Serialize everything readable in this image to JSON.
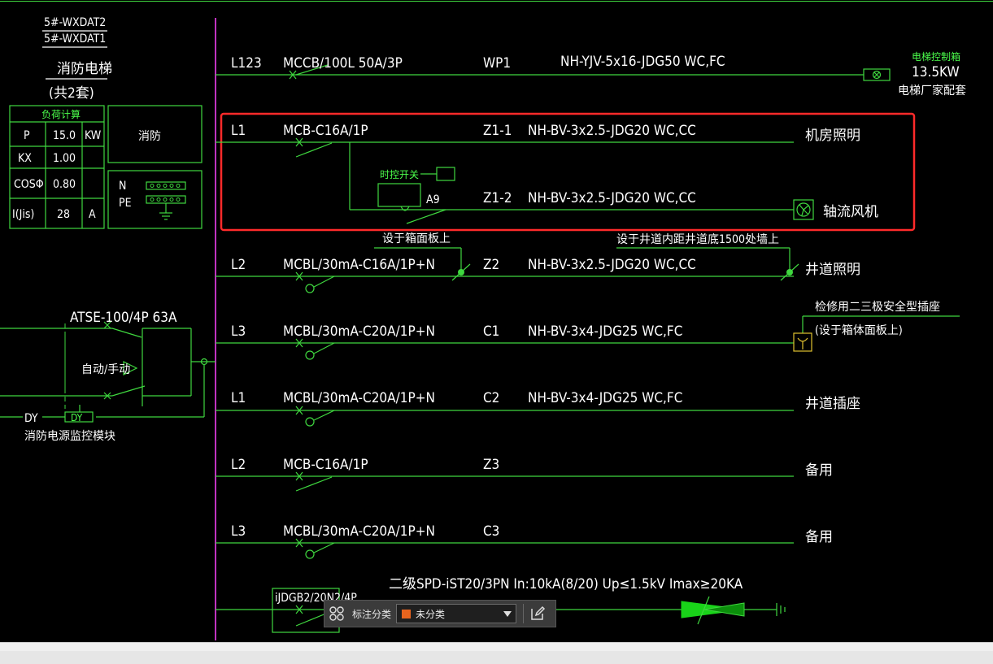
{
  "panel": {
    "ids": [
      "5#-WXDAT2",
      "5#-WXDAT1"
    ],
    "title": "消防电梯",
    "count": "(共2套)",
    "load_table_title": "负荷计算",
    "load_rows": [
      {
        "param": "P",
        "value": "15.0",
        "unit": "KW"
      },
      {
        "param": "KX",
        "value": "1.00",
        "unit": ""
      },
      {
        "param": "COSΦ",
        "value": "0.80",
        "unit": ""
      },
      {
        "param": "I(Jis)",
        "value": "28",
        "unit": "A"
      }
    ],
    "fire_label": "消防",
    "n_label": "N",
    "pe_label": "PE"
  },
  "atse": {
    "label": "ATSE-100/4P 63A",
    "mode_label": "自动/手动",
    "dy_box": "DY",
    "dy_line": "DY",
    "monitor_label": "消防电源监控模块"
  },
  "circuits": [
    {
      "phase": "L123",
      "breaker": "MCCB/100L 50A/3P",
      "id": "WP1",
      "cable": "NH-YJV-5x16-JDG50  WC,FC",
      "load": ""
    },
    {
      "phase": "L1",
      "breaker": "MCB-C16A/1P",
      "id": "Z1-1",
      "cable": "NH-BV-3x2.5-JDG20  WC,CC",
      "load": "机房照明"
    },
    {
      "phase": "",
      "breaker": "",
      "id": "Z1-2",
      "cable": "NH-BV-3x2.5-JDG20  WC,CC",
      "load": "轴流风机"
    },
    {
      "phase": "L2",
      "breaker": "MCBL/30mA-C16A/1P+N",
      "id": "Z2",
      "cable": "NH-BV-3x2.5-JDG20  WC,CC",
      "load": "井道照明"
    },
    {
      "phase": "L3",
      "breaker": "MCBL/30mA-C20A/1P+N",
      "id": "C1",
      "cable": "NH-BV-3x4-JDG25  WC,FC",
      "load": ""
    },
    {
      "phase": "L1",
      "breaker": "MCBL/30mA-C20A/1P+N",
      "id": "C2",
      "cable": "NH-BV-3x4-JDG25  WC,FC",
      "load": "井道插座"
    },
    {
      "phase": "L2",
      "breaker": "MCB-C16A/1P",
      "id": "Z3",
      "cable": "",
      "load": "备用"
    },
    {
      "phase": "L3",
      "breaker": "MCBL/30mA-C20A/1P+N",
      "id": "C3",
      "cable": "",
      "load": "备用"
    }
  ],
  "elevator_ctrl": {
    "title": "电梯控制箱",
    "power": "13.5KW",
    "note": "电梯厂家配套"
  },
  "timer_switch": "时控开关",
  "a9_label": "A9",
  "note_on_panel": "设于箱面板上",
  "note_shaft": "设于井道内距井道底1500处墙上",
  "socket_note1": "检修用二三极安全型插座",
  "socket_note2": "(设于箱体面板上)",
  "spd": {
    "label": "二级SPD-iST20/3PN In:10kA(8/20) Up≤1.5kV Imax≥20KA",
    "breaker": "iJDGB2/20N2/4P"
  },
  "toolbar": {
    "label": "标注分类",
    "selected": "未分类",
    "swatch_color": "#e8641e"
  },
  "colors": {
    "highlight": "#ff2a2a",
    "bus": "#ff44ff",
    "symbols": "#3fd73f"
  }
}
